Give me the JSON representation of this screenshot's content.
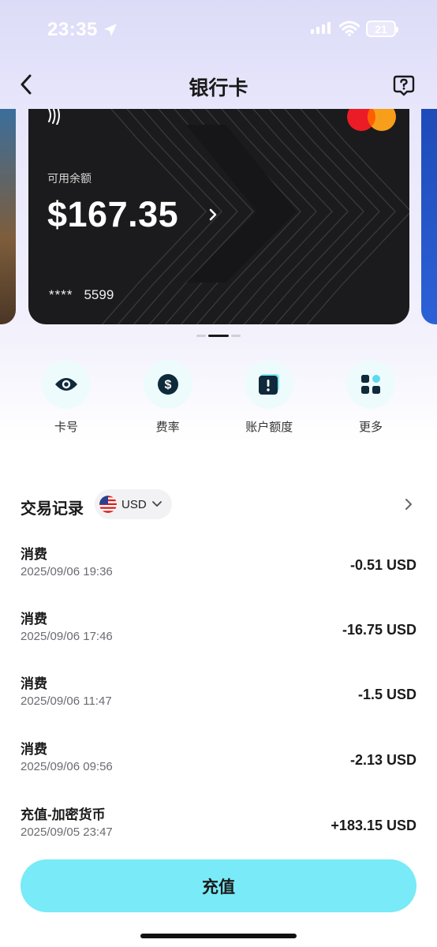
{
  "status_bar": {
    "time": "23:35",
    "battery": "21"
  },
  "header": {
    "title": "银行卡",
    "back_icon": "chevron-left-icon",
    "help_icon": "help-icon"
  },
  "card": {
    "available_label": "可用余额",
    "balance": "$167.35",
    "card_mask": "****",
    "card_last4": "5599",
    "brand": "mastercard"
  },
  "pager": {
    "count": 3,
    "active": 1
  },
  "actions": [
    {
      "label": "卡号",
      "icon": "eye-icon"
    },
    {
      "label": "费率",
      "icon": "dollar-icon"
    },
    {
      "label": "账户额度",
      "icon": "alert-icon"
    },
    {
      "label": "更多",
      "icon": "grid-icon"
    }
  ],
  "transactions": {
    "title": "交易记录",
    "currency": "USD",
    "items": [
      {
        "name": "消费",
        "date": "2025/09/06 19:36",
        "amount": "-0.51 USD"
      },
      {
        "name": "消费",
        "date": "2025/09/06 17:46",
        "amount": "-16.75 USD"
      },
      {
        "name": "消费",
        "date": "2025/09/06 11:47",
        "amount": "-1.5 USD"
      },
      {
        "name": "消费",
        "date": "2025/09/06 09:56",
        "amount": "-2.13 USD"
      },
      {
        "name": "充值-加密货币",
        "date": "2025/09/05 23:47",
        "amount": "+183.15 USD"
      }
    ]
  },
  "bottom": {
    "recharge_label": "充值"
  },
  "colors": {
    "accent": "#79eaf7",
    "card_bg": "#1b1b1d",
    "icon_bg": "#eefbfd"
  }
}
